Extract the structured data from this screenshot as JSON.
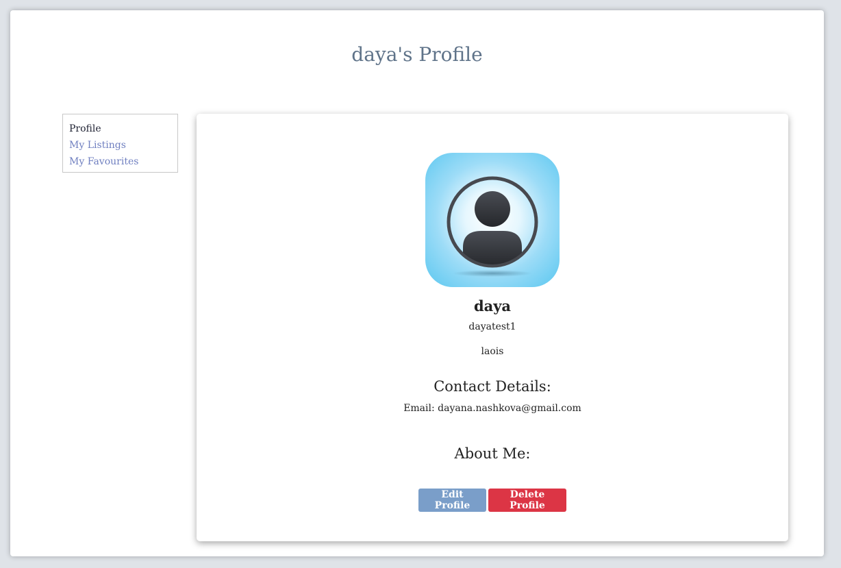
{
  "page": {
    "title": "daya's Profile"
  },
  "sidebar": {
    "items": [
      {
        "label": "Profile",
        "active": true
      },
      {
        "label": "My Listings",
        "active": false
      },
      {
        "label": "My Favourites",
        "active": false
      }
    ]
  },
  "profile": {
    "avatar_icon": "user-avatar-icon",
    "name": "daya",
    "username": "dayatest1",
    "location": "laois",
    "contact_heading": "Contact Details:",
    "email": "Email: dayana.nashkova@gmail.com",
    "about_heading": "About Me:"
  },
  "actions": {
    "edit_label": "Edit Profile",
    "delete_label": "Delete Profile"
  },
  "colors": {
    "edit_button": "#7a9ec9",
    "delete_button": "#dc3545",
    "nav_link": "#6f7fc0",
    "title": "#5f7389"
  }
}
